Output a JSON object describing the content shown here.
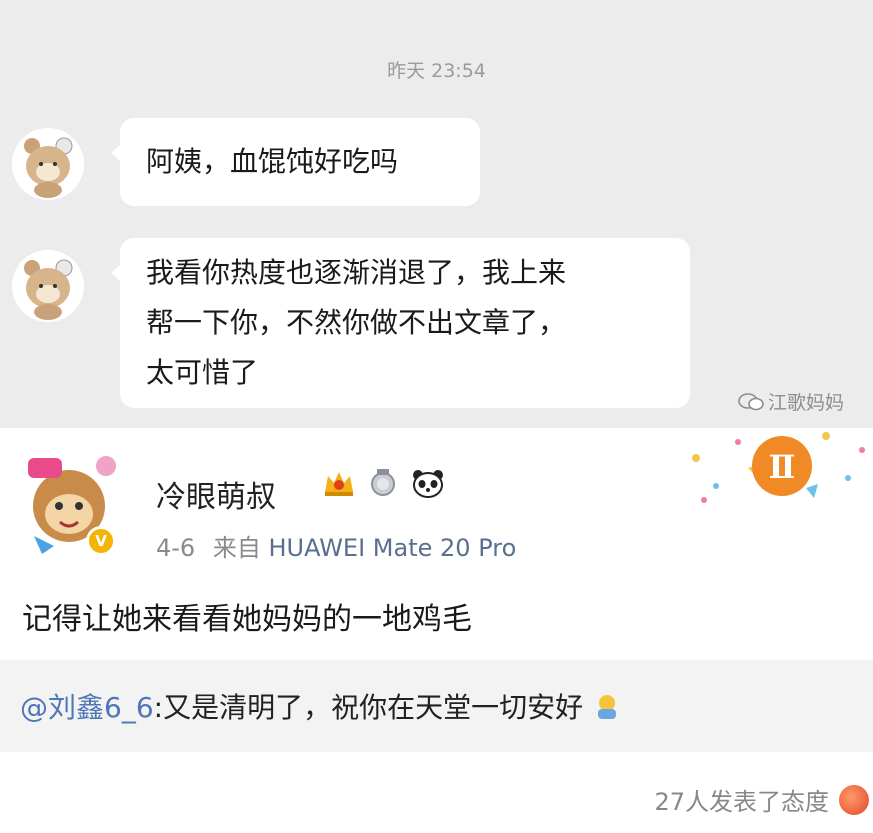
{
  "chat": {
    "timestamp": "昨天 23:54",
    "messages": [
      {
        "text": "阿姨，血馄饨好吃吗"
      },
      {
        "lines": [
          "我看你热度也逐渐消退了，我上来",
          "帮一下你，不然你做不出文章了，",
          "太可惜了"
        ]
      }
    ],
    "watermark": "江歌妈妈"
  },
  "post": {
    "username": "冷眼萌叔",
    "date": "4-6",
    "source_prefix": "来自",
    "device": "HUAWEI Mate 20 Pro",
    "content": "记得让她来看看她妈妈的一地鸡毛",
    "quote": {
      "mention": "@刘鑫6_6",
      "text": ":又是清明了，祝你在天堂一切安好"
    },
    "reactions_text": "27人发表了态度"
  },
  "colors": {
    "chat_bg": "#ececec",
    "mention": "#4f76b7",
    "verified": "#f5b400",
    "gemini_badge": "#f08a24"
  }
}
